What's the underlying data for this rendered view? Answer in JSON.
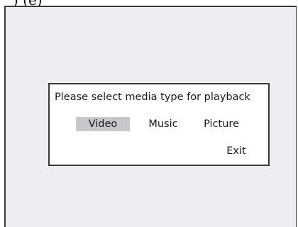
{
  "header": {
    "caption": ") (e)"
  },
  "dialog": {
    "prompt": "Please select media type for playback",
    "options": [
      {
        "label": "Video",
        "selected": true
      },
      {
        "label": "Music",
        "selected": false
      },
      {
        "label": "Picture",
        "selected": false
      }
    ],
    "exit_label": "Exit"
  },
  "colors": {
    "screen_background": "#eeeef2",
    "dialog_background": "#ffffff",
    "selection_highlight": "#c7c7cb",
    "border": "#3a3a3a"
  }
}
